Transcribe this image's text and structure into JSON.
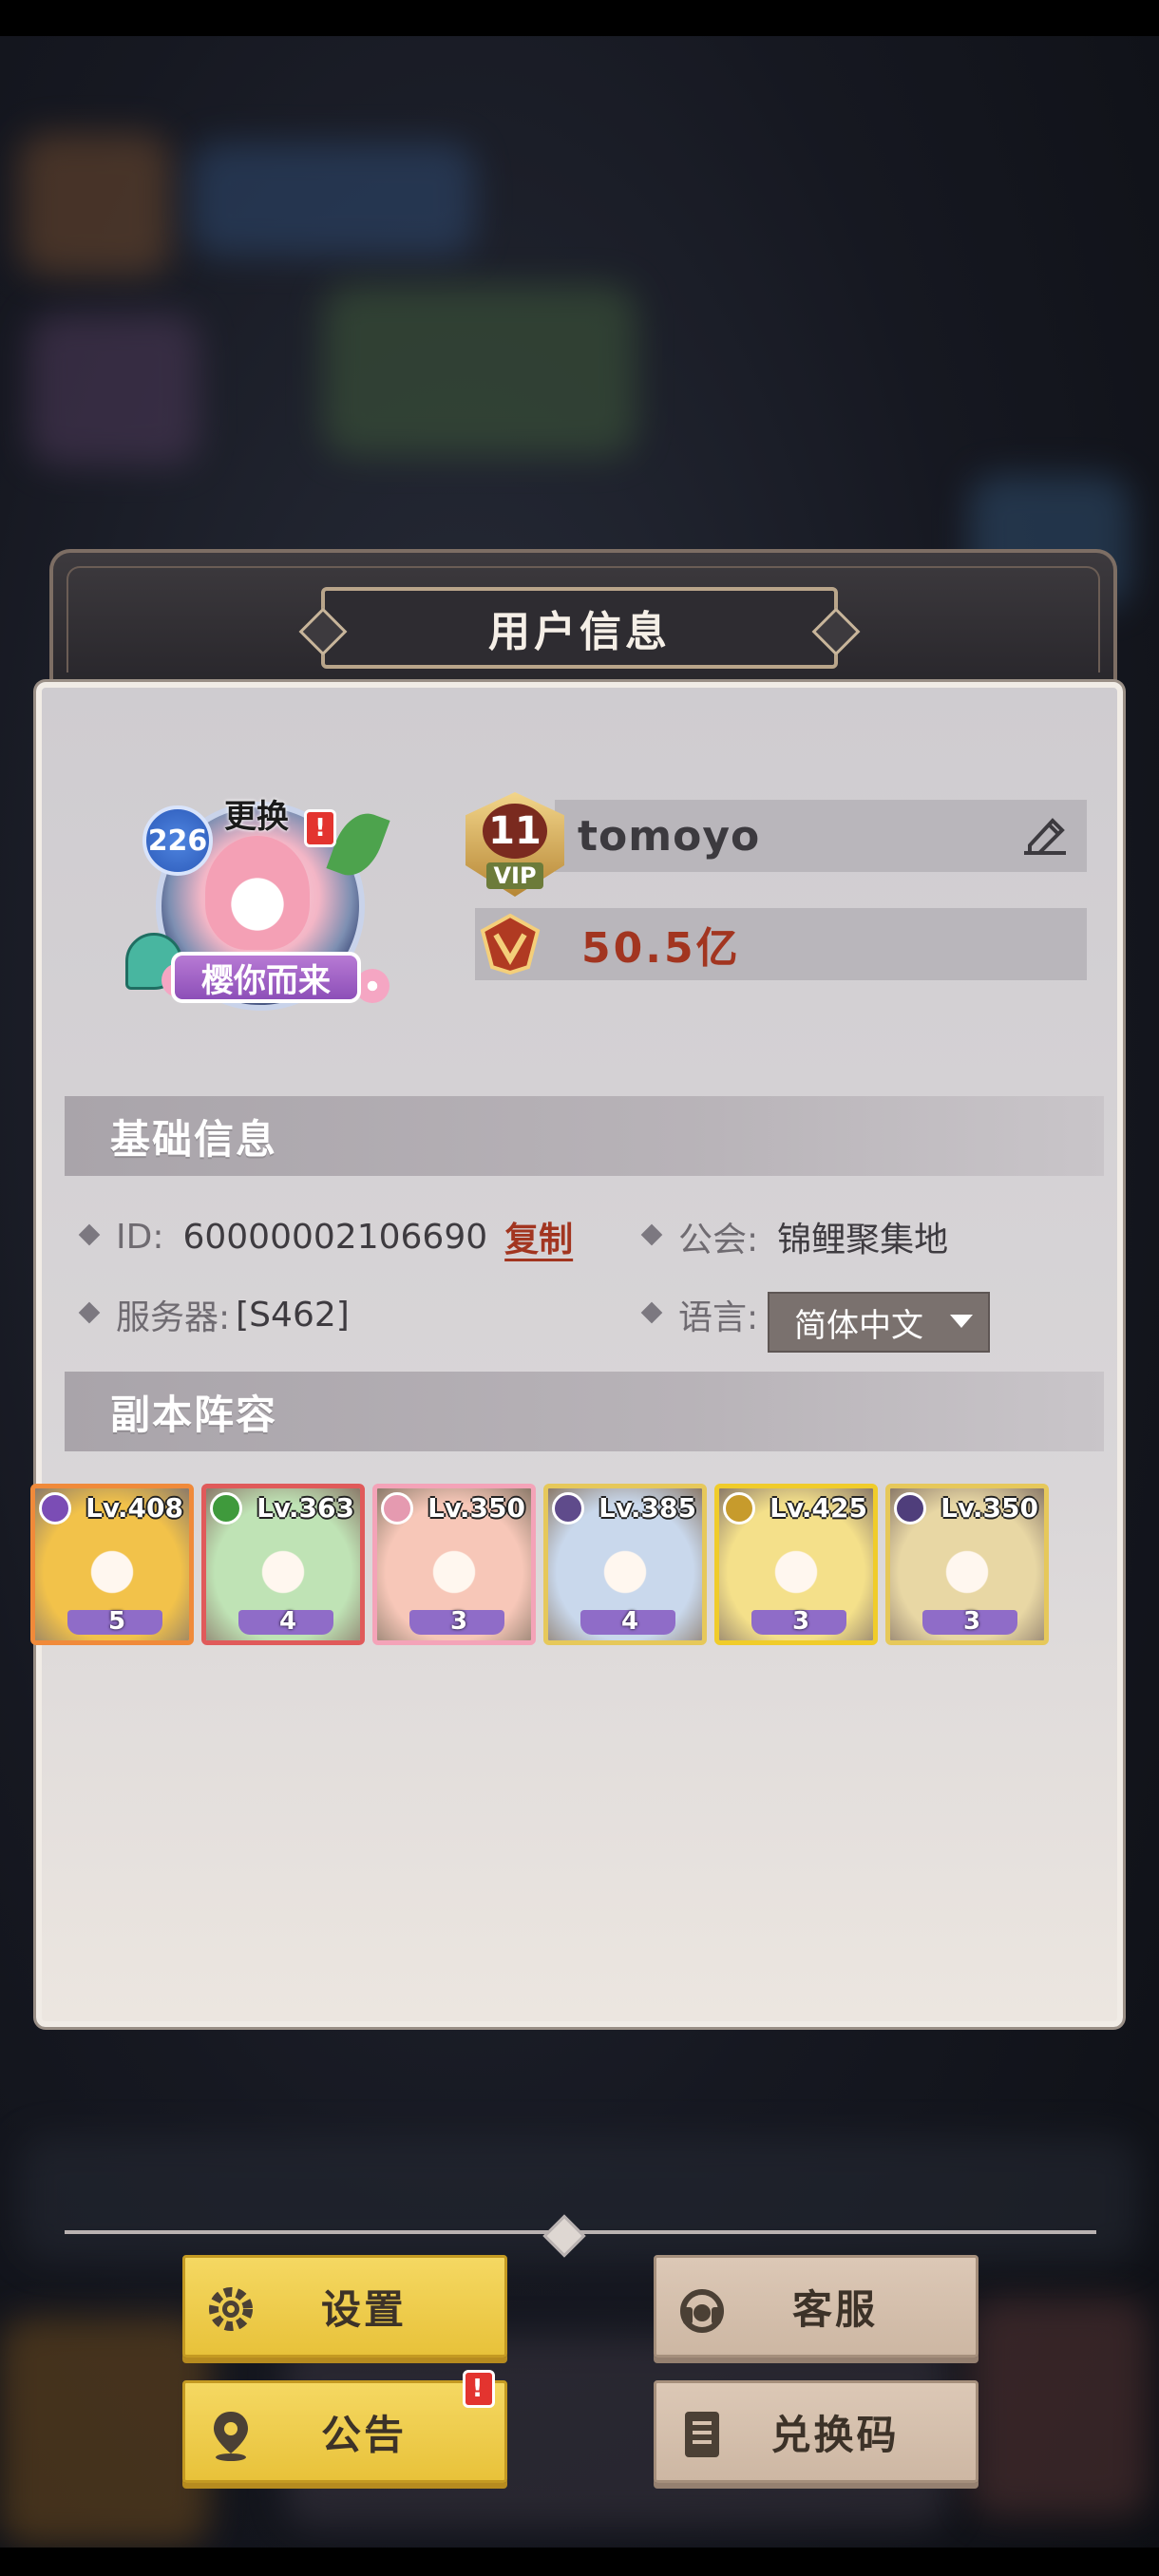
{
  "dialog": {
    "title": "用户信息"
  },
  "profile": {
    "level": "226",
    "change_label": "更换",
    "avatar_frame_label": "樱你而来",
    "vip_level": "11",
    "vip_label": "VIP",
    "username": "tomoyo",
    "power": "50.5亿"
  },
  "basic_info": {
    "header": "基础信息",
    "id_label": "ID:",
    "id_value": "60000002106690",
    "copy_label": "复制",
    "guild_label": "公会:",
    "guild_value": "锦鲤聚集地",
    "server_label": "服务器:",
    "server_value": "[S462]",
    "language_label": "语言:",
    "language_value": "简体中文"
  },
  "team": {
    "header": "副本阵容",
    "heroes": [
      {
        "level": "Lv.408",
        "stars": "5",
        "element": "dark",
        "element_color": "#7b4db5",
        "border": "#f08a3a",
        "bg": "#f2c24a"
      },
      {
        "level": "Lv.363",
        "stars": "4",
        "element": "nature",
        "element_color": "#3f9a3c",
        "border": "#e05a5a",
        "bg": "#bfe3b5"
      },
      {
        "level": "Lv.350",
        "stars": "3",
        "element": "light",
        "element_color": "#e59ab0",
        "border": "#f4a3b8",
        "bg": "#f7c7b8"
      },
      {
        "level": "Lv.385",
        "stars": "4",
        "element": "dark",
        "element_color": "#5f4b8b",
        "border": "#e6c85a",
        "bg": "#c9d8ec"
      },
      {
        "level": "Lv.425",
        "stars": "3",
        "element": "holy",
        "element_color": "#c79b2c",
        "border": "#f0cc2a",
        "bg": "#f4e08a"
      },
      {
        "level": "Lv.350",
        "stars": "3",
        "element": "dark",
        "element_color": "#4f3e7b",
        "border": "#e6c85a",
        "bg": "#e8d7a4"
      }
    ]
  },
  "buttons": {
    "settings": "设置",
    "support": "客服",
    "notice": "公告",
    "redeem": "兑换码",
    "notice_alert": "!"
  },
  "colors": {
    "accent_red": "#a23520",
    "button_yellow": "#f0cd4e",
    "button_tan": "#d6c1ae",
    "panel": "#d3d0d4"
  }
}
